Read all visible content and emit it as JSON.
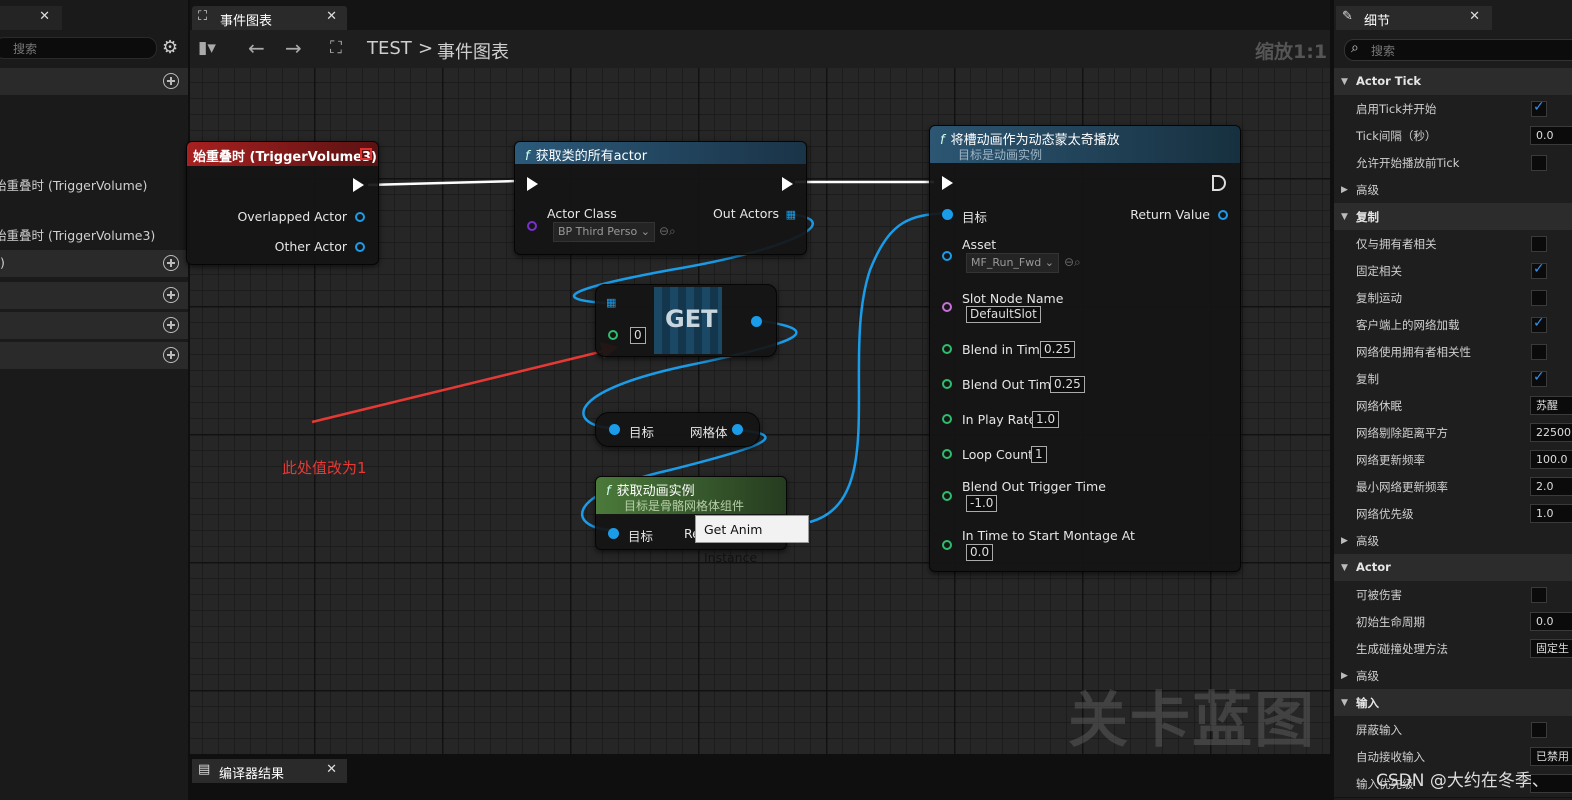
{
  "left_panel": {
    "search_placeholder": "搜索",
    "items": [
      "始重叠时 (TriggerVolume)",
      "始重叠时 (TriggerVolume3)"
    ],
    "row_label": ")"
  },
  "graph_tab": {
    "label": "事件图表"
  },
  "breadcrumb": {
    "root": "TEST",
    "sep": ">",
    "current": "事件图表"
  },
  "zoom": "缩放1:1",
  "nodes": {
    "event": {
      "title": "始重叠时 (TriggerVolume3)",
      "pins": [
        "Overlapped Actor",
        "Other Actor"
      ]
    },
    "get_all": {
      "title": "获取类的所有actor",
      "in_label": "Actor Class",
      "class_value": "BP Third Perso",
      "out_label": "Out Actors"
    },
    "get": {
      "title": "GET",
      "index": "0"
    },
    "mesh": {
      "in_label": "目标",
      "out_label": "网格体"
    },
    "anim": {
      "title": "获取动画实例",
      "subtitle": "目标是骨骼网格体组件",
      "in_label": "目标",
      "out_label_partial": "Re"
    },
    "montage": {
      "title": "将槽动画作为动态蒙太奇播放",
      "subtitle": "目标是动画实例",
      "target": "目标",
      "return": "Return Value",
      "asset_label": "Asset",
      "asset_value": "MF_Run_Fwd",
      "slot_label": "Slot Node Name",
      "slot_value": "DefaultSlot",
      "blend_in_label": "Blend in Time",
      "blend_in": "0.25",
      "blend_out_label": "Blend Out Time",
      "blend_out": "0.25",
      "rate_label": "In Play Rate",
      "rate": "1.0",
      "loop_label": "Loop Count",
      "loop": "1",
      "trigger_label": "Blend Out Trigger Time",
      "trigger": "-1.0",
      "start_label": "In Time to Start Montage At",
      "start": "0.0"
    }
  },
  "tooltip": "Get Anim Instance",
  "annotation": "此处值改为1",
  "watermark": "关卡蓝图",
  "bottom_tab": {
    "label": "编译器结果"
  },
  "details": {
    "tab_label": "细节",
    "search_placeholder": "搜索",
    "rows": [
      {
        "kind": "section",
        "label": "Actor Tick"
      },
      {
        "kind": "check",
        "label": "启用Tick并开始",
        "checked": true
      },
      {
        "kind": "value",
        "label": "Tick间隔（秒）",
        "value": "0.0"
      },
      {
        "kind": "check",
        "label": "允许开始播放前Tick",
        "checked": false
      },
      {
        "kind": "adv",
        "label": "高级"
      },
      {
        "kind": "section",
        "label": "复制"
      },
      {
        "kind": "check",
        "label": "仅与拥有者相关",
        "checked": false
      },
      {
        "kind": "check",
        "label": "固定相关",
        "checked": true
      },
      {
        "kind": "check",
        "label": "复制运动",
        "checked": false
      },
      {
        "kind": "check",
        "label": "客户端上的网络加载",
        "checked": true
      },
      {
        "kind": "check",
        "label": "网络使用拥有者相关性",
        "checked": false
      },
      {
        "kind": "check",
        "label": "复制",
        "checked": true
      },
      {
        "kind": "value",
        "label": "网络休眠",
        "value": "苏醒"
      },
      {
        "kind": "value",
        "label": "网络剔除距离平方",
        "value": "22500"
      },
      {
        "kind": "value",
        "label": "网络更新频率",
        "value": "100.0"
      },
      {
        "kind": "value",
        "label": "最小网络更新频率",
        "value": "2.0"
      },
      {
        "kind": "value",
        "label": "网络优先级",
        "value": "1.0"
      },
      {
        "kind": "adv",
        "label": "高级"
      },
      {
        "kind": "section",
        "label": "Actor"
      },
      {
        "kind": "check",
        "label": "可被伤害",
        "checked": false
      },
      {
        "kind": "value",
        "label": "初始生命周期",
        "value": "0.0"
      },
      {
        "kind": "value",
        "label": "生成碰撞处理方法",
        "value": "固定生"
      },
      {
        "kind": "adv",
        "label": "高级"
      },
      {
        "kind": "section",
        "label": "输入"
      },
      {
        "kind": "check",
        "label": "屏蔽输入",
        "checked": false
      },
      {
        "kind": "value",
        "label": "自动接收输入",
        "value": "已禁用"
      },
      {
        "kind": "value",
        "label": "输入优先级",
        "value": ""
      }
    ]
  },
  "csdn": "CSDN @大约在冬季、"
}
